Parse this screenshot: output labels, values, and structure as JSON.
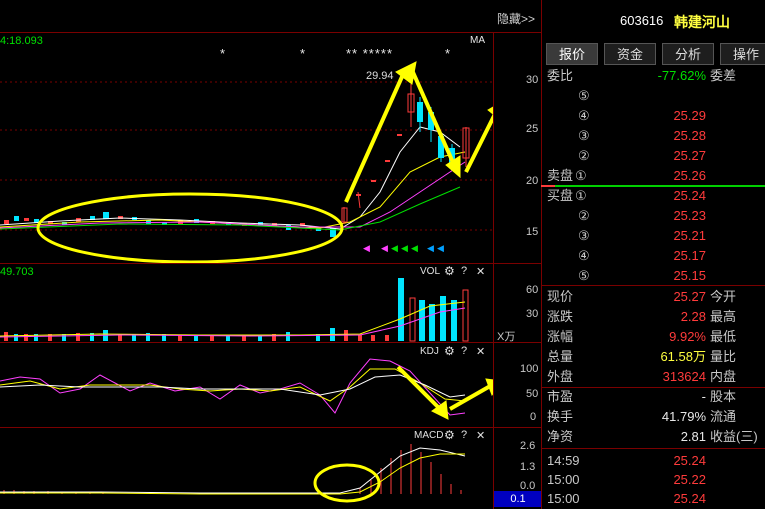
{
  "toolbar": {
    "hide_label": "隐藏>>"
  },
  "stock": {
    "code": "603616",
    "name": "韩建河山"
  },
  "tabs": [
    "报价",
    "资金",
    "分析",
    "操作"
  ],
  "main_chart": {
    "top_left_value": "4:18.093",
    "ma_label": "MA",
    "high_label": "29.94",
    "stars_a": "*",
    "stars_b": "*",
    "stars_c": "** *****",
    "stars_d": "*",
    "y_ticks": [
      "30",
      "25",
      "20",
      "15"
    ]
  },
  "vol_chart": {
    "title": "VOL",
    "value_label": "49.703",
    "y_ticks": [
      "60",
      "30"
    ],
    "unit": "X万"
  },
  "kdj_chart": {
    "title": "KDJ",
    "y_ticks": [
      "100",
      "50",
      "0"
    ]
  },
  "macd_chart": {
    "title": "MACD",
    "y_ticks": [
      "2.6",
      "1.3",
      "0.0"
    ],
    "current": "0.1"
  },
  "panel_icons": {
    "gear": "⚙",
    "help": "?",
    "close": "✕"
  },
  "quote": {
    "weibi_label": "委比",
    "weibi_value": "-77.62%",
    "weicha_label": "委差",
    "sell_label": "卖盘",
    "buy_label": "买盘",
    "sell": [
      {
        "n": "⑤",
        "price": ""
      },
      {
        "n": "④",
        "price": "25.29"
      },
      {
        "n": "③",
        "price": "25.28"
      },
      {
        "n": "②",
        "price": "25.27"
      },
      {
        "n": "①",
        "price": "25.26"
      }
    ],
    "buy": [
      {
        "n": "①",
        "price": "25.24"
      },
      {
        "n": "②",
        "price": "25.23"
      },
      {
        "n": "③",
        "price": "25.21"
      },
      {
        "n": "④",
        "price": "25.17"
      },
      {
        "n": "⑤",
        "price": "25.15"
      }
    ],
    "stats": [
      {
        "l": "现价",
        "v": "25.27",
        "r": "今开",
        "c": "red"
      },
      {
        "l": "涨跌",
        "v": "2.28",
        "r": "最高",
        "c": "red"
      },
      {
        "l": "涨幅",
        "v": "9.92%",
        "r": "最低",
        "c": "red"
      },
      {
        "l": "总量",
        "v": "61.58万",
        "r": "量比",
        "c": "yellow"
      },
      {
        "l": "外盘",
        "v": "313624",
        "r": "内盘",
        "c": "red"
      },
      {
        "l": "市盈",
        "v": "-",
        "r": "股本",
        "c": "white"
      },
      {
        "l": "换手",
        "v": "41.79%",
        "r": "流通",
        "c": "white"
      },
      {
        "l": "净资",
        "v": "2.81",
        "r": "收益(三)",
        "c": "white"
      }
    ],
    "ticks": [
      {
        "t": "14:59",
        "p": "25.24"
      },
      {
        "t": "15:00",
        "p": "25.22"
      },
      {
        "t": "15:00",
        "p": "25.24"
      }
    ]
  },
  "colors": {
    "up": "#ff3b3b",
    "down": "#00e5ff",
    "grid": "#7a0000",
    "annot": "#ffff00"
  }
}
